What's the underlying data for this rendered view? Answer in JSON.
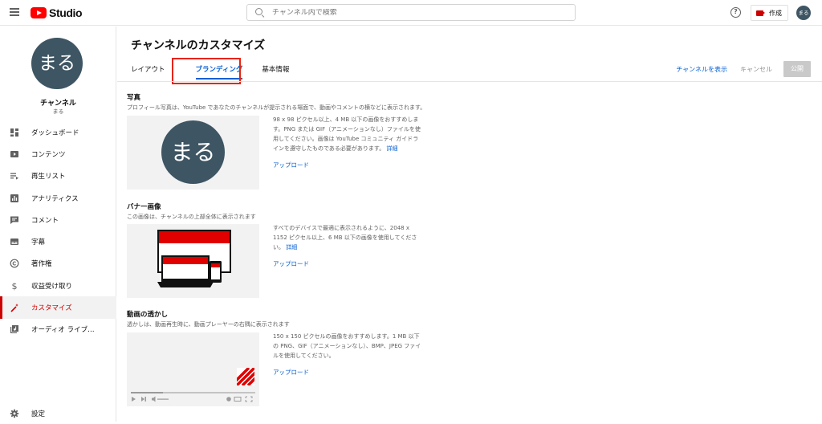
{
  "header": {
    "logo_text": "Studio",
    "search_placeholder": "チャンネル内で検索",
    "help_glyph": "?",
    "create_label": "作成",
    "avatar_text": "まる"
  },
  "sidebar": {
    "avatar_text": "まる",
    "channel_label": "チャンネル",
    "channel_name": "まる",
    "items": [
      {
        "label": "ダッシュボード",
        "icon": "dashboard-icon"
      },
      {
        "label": "コンテンツ",
        "icon": "content-icon"
      },
      {
        "label": "再生リスト",
        "icon": "playlist-icon"
      },
      {
        "label": "アナリティクス",
        "icon": "analytics-icon"
      },
      {
        "label": "コメント",
        "icon": "comment-icon"
      },
      {
        "label": "字幕",
        "icon": "subtitles-icon"
      },
      {
        "label": "著作権",
        "icon": "copyright-icon"
      },
      {
        "label": "収益受け取り",
        "icon": "dollar-icon"
      },
      {
        "label": "カスタマイズ",
        "icon": "customize-wand-icon",
        "active": true
      },
      {
        "label": "オーディオ ライブ…",
        "icon": "audio-library-icon"
      }
    ],
    "settings_label": "設定"
  },
  "main": {
    "title": "チャンネルのカスタマイズ",
    "tabs": [
      {
        "label": "レイアウト"
      },
      {
        "label": "ブランディング",
        "active": true
      },
      {
        "label": "基本情報"
      }
    ],
    "actions": {
      "view_channel": "チャンネルを表示",
      "cancel": "キャンセル",
      "publish": "公開"
    },
    "photo": {
      "title": "写真",
      "desc": "プロフィール写真は、YouTube であなたのチャンネルが提示される場面で、動画やコメントの横などに表示されます。",
      "preview_text": "まる",
      "info": "98 x 98 ピクセル以上、4 MB 以下の画像をおすすめします。PNG または GIF（アニメーションなし）ファイルを使用してください。画像は YouTube コミュニティ ガイドラインを遵守したものである必要があります。",
      "details": "詳細",
      "upload": "アップロード"
    },
    "banner": {
      "title": "バナー画像",
      "desc": "この画像は、チャンネルの上部全体に表示されます",
      "info": "すべてのデバイスで最適に表示されるように、2048 x 1152 ピクセル以上、6 MB 以下の画像を使用してください。",
      "details": "詳細",
      "upload": "アップロード"
    },
    "watermark": {
      "title": "動画の透かし",
      "desc": "透かしは、動画再生時に、動画プレーヤーの右隅に表示されます",
      "info": "150 x 150 ピクセルの画像をおすすめします。1 MB 以下の PNG、GIF（アニメーションなし）、BMP、JPEG ファイルを使用してください。",
      "upload": "アップロード"
    }
  },
  "colors": {
    "accent_red": "#cc0000",
    "link_blue": "#065fd4",
    "avatar_bg": "#3e5563",
    "highlight_box": "#e8240e"
  }
}
